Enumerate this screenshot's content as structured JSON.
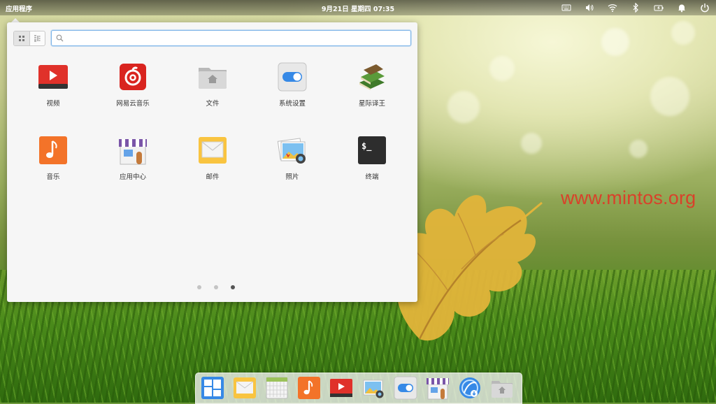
{
  "top_panel": {
    "apps_label": "应用程序",
    "clock": "9月21日 星期四   07:35",
    "tray_icons": [
      "keyboard-icon",
      "volume-icon",
      "wifi-icon",
      "bluetooth-icon",
      "battery-icon",
      "notification-bell-icon",
      "power-icon"
    ]
  },
  "launcher": {
    "view_modes": [
      "grid-view-icon",
      "category-view-icon"
    ],
    "active_view": "grid",
    "search": {
      "value": "",
      "placeholder": ""
    },
    "apps": [
      {
        "label": "视频",
        "icon": "video-icon"
      },
      {
        "label": "网易云音乐",
        "icon": "netease-music-icon"
      },
      {
        "label": "文件",
        "icon": "files-folder-icon"
      },
      {
        "label": "系统设置",
        "icon": "settings-toggle-icon"
      },
      {
        "label": "星际译王",
        "icon": "dictionary-books-icon"
      },
      {
        "label": "音乐",
        "icon": "music-note-icon"
      },
      {
        "label": "应用中心",
        "icon": "app-center-store-icon"
      },
      {
        "label": "邮件",
        "icon": "mail-envelope-icon"
      },
      {
        "label": "照片",
        "icon": "photos-icon"
      },
      {
        "label": "终端",
        "icon": "terminal-icon"
      }
    ],
    "pages": 3,
    "current_page": 3
  },
  "dock": {
    "items": [
      "multitasking-view-icon",
      "mail-envelope-icon",
      "calendar-icon",
      "music-note-icon",
      "video-icon",
      "photos-icon",
      "settings-toggle-icon",
      "app-center-store-icon",
      "browser-download-icon",
      "files-folder-icon"
    ]
  },
  "wallpaper": {
    "watermark_text": "www.mintos.org"
  },
  "colors": {
    "accent": "#3689e6",
    "search_focus_border": "#7cb4e8",
    "watermark": "#d9412a",
    "video_red": "#e0312a",
    "music_orange": "#f37329",
    "terminal_dark": "#2d2d2d"
  }
}
